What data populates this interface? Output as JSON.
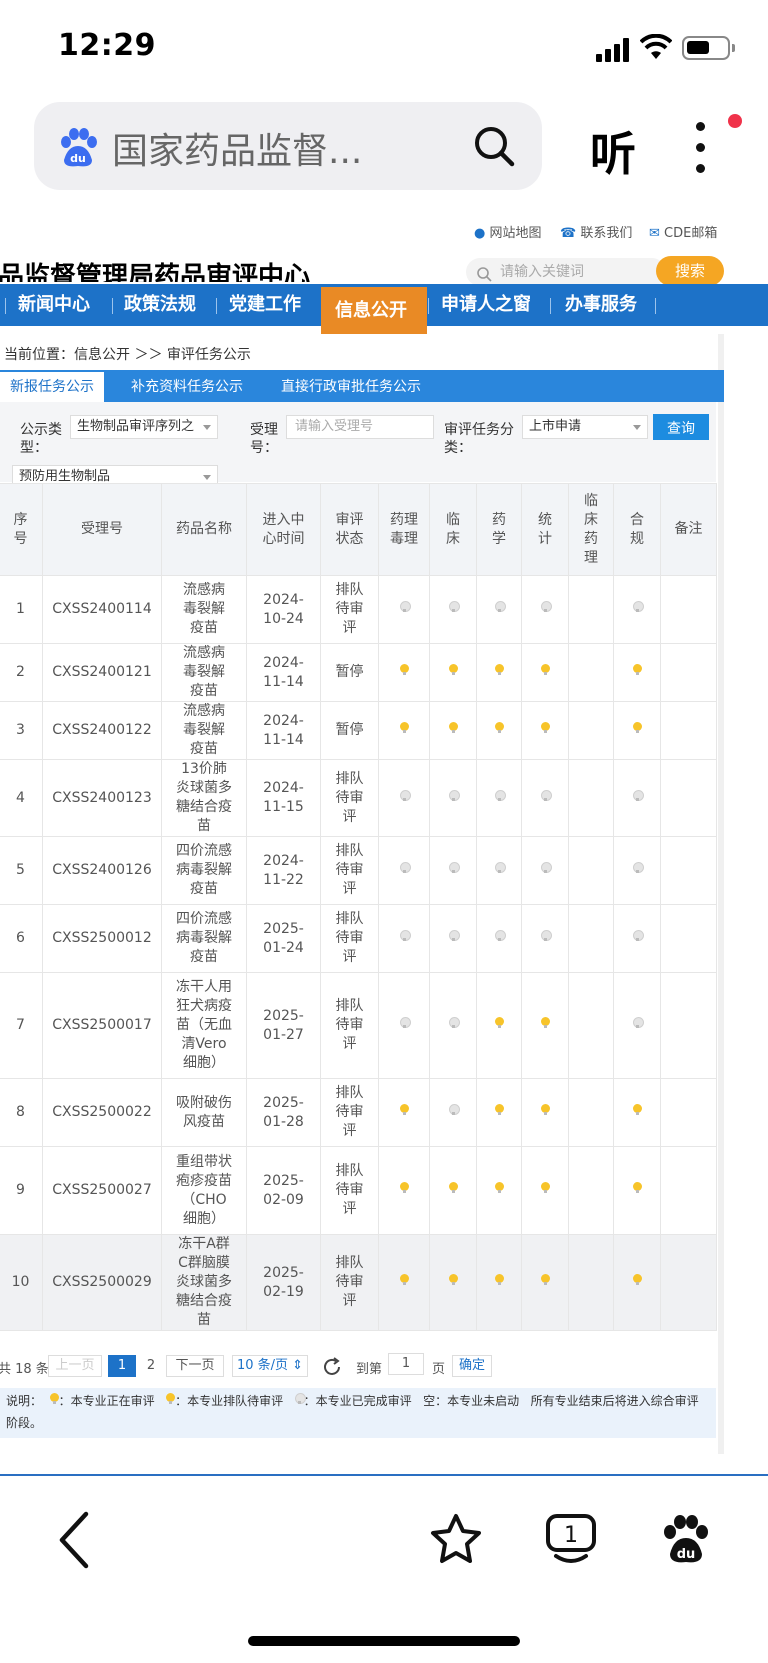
{
  "status": {
    "time": "12:29"
  },
  "browser": {
    "search_title": "国家药品监督...",
    "listen_label": "听"
  },
  "site": {
    "toplinks": {
      "sitemap": "网站地图",
      "contact": "联系我们",
      "mail": "CDE邮箱"
    },
    "title": "药品监督管理局药品审评中心",
    "search_placeholder": "请输入关键词",
    "search_button": "搜索"
  },
  "nav": [
    "新闻中心",
    "政策法规",
    "党建工作",
    "信息公开",
    "申请人之窗",
    "办事服务"
  ],
  "breadcrumb": "当前位置：信息公开 ＞＞ 审评任务公示",
  "tabs": [
    "新报任务公示",
    "补充资料任务公示",
    "直接行政审批任务公示"
  ],
  "filters": {
    "type_label": "公示类型：",
    "type_value": "生物制品审评序列之",
    "accept_label": "受理号：",
    "accept_placeholder": "请输入受理号",
    "task_label": "审评任务分类：",
    "task_value": "上市申请",
    "subtype_value": "预防用生物制品",
    "query_button": "查询"
  },
  "table": {
    "headers": [
      "序号",
      "受理号",
      "药品名称",
      "进入中心时间",
      "审评状态",
      "药理毒理",
      "临床",
      "药学",
      "统计",
      "临床药理",
      "合规",
      "备注"
    ],
    "rows": [
      {
        "no": "1",
        "id": "CXSS2400114",
        "name": "流感病毒裂解疫苗",
        "date": "2024-10-24",
        "status": "排队待审评",
        "marks": [
          "g",
          "g",
          "g",
          "g",
          "",
          "g"
        ]
      },
      {
        "no": "2",
        "id": "CXSS2400121",
        "name": "流感病毒裂解疫苗",
        "date": "2024-11-14",
        "status": "暂停",
        "marks": [
          "y",
          "y",
          "y",
          "y",
          "",
          "y"
        ]
      },
      {
        "no": "3",
        "id": "CXSS2400122",
        "name": "流感病毒裂解疫苗",
        "date": "2024-11-14",
        "status": "暂停",
        "marks": [
          "y",
          "y",
          "y",
          "y",
          "",
          "y"
        ]
      },
      {
        "no": "4",
        "id": "CXSS2400123",
        "name": "13价肺炎球菌多糖结合疫苗",
        "date": "2024-11-15",
        "status": "排队待审评",
        "marks": [
          "g",
          "g",
          "g",
          "g",
          "",
          "g"
        ]
      },
      {
        "no": "5",
        "id": "CXSS2400126",
        "name": "四价流感病毒裂解疫苗",
        "date": "2024-11-22",
        "status": "排队待审评",
        "marks": [
          "g",
          "g",
          "g",
          "g",
          "",
          "g"
        ]
      },
      {
        "no": "6",
        "id": "CXSS2500012",
        "name": "四价流感病毒裂解疫苗",
        "date": "2025-01-24",
        "status": "排队待审评",
        "marks": [
          "g",
          "g",
          "g",
          "g",
          "",
          "g"
        ]
      },
      {
        "no": "7",
        "id": "CXSS2500017",
        "name": "冻干人用狂犬病疫苗（无血清Vero细胞）",
        "date": "2025-01-27",
        "status": "排队待审评",
        "marks": [
          "g",
          "g",
          "y",
          "y",
          "",
          "g"
        ]
      },
      {
        "no": "8",
        "id": "CXSS2500022",
        "name": "吸附破伤风疫苗",
        "date": "2025-01-28",
        "status": "排队待审评",
        "marks": [
          "y",
          "g",
          "y",
          "y",
          "",
          "y"
        ]
      },
      {
        "no": "9",
        "id": "CXSS2500027",
        "name": "重组带状疱疹疫苗（CHO细胞）",
        "date": "2025-02-09",
        "status": "排队待审评",
        "marks": [
          "y",
          "y",
          "y",
          "y",
          "",
          "y"
        ]
      },
      {
        "no": "10",
        "id": "CXSS2500029",
        "name": "冻干A群C群脑膜炎球菌多糖结合疫苗",
        "date": "2025-02-19",
        "status": "排队待审评",
        "marks": [
          "y",
          "y",
          "y",
          "y",
          "",
          "y"
        ]
      }
    ]
  },
  "pagination": {
    "total": "共 18 条",
    "prev": "上一页",
    "page1": "1",
    "page2": "2",
    "next": "下一页",
    "per_page": "10 条/页",
    "goto": "到第",
    "goto_value": "1",
    "page_unit": "页",
    "confirm": "确定"
  },
  "legend": {
    "prefix": "说明：",
    "a": "本专业正在审评",
    "b": "本专业排队待审评",
    "c": "本专业已完成审评",
    "d": "空：本专业未启动",
    "e": "所有专业结束后将进入综合审评阶段。"
  }
}
